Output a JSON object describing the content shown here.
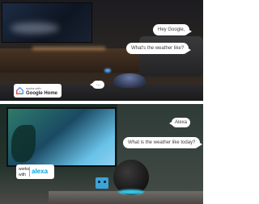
{
  "top_panel": {
    "bubbles": [
      {
        "text": "Hey Google,"
      },
      {
        "text": "What's the weather like?"
      },
      {
        "text": "..."
      }
    ],
    "badge": {
      "works_with": "works with",
      "name": "Google Home"
    }
  },
  "bottom_panel": {
    "bubbles": [
      {
        "text": "Alexa"
      },
      {
        "text": "What is the weather like today?"
      }
    ],
    "badge": {
      "works": "works",
      "with": "with",
      "name": "alexa"
    }
  },
  "colors": {
    "alexa_ring": "#36c9e8",
    "alexa_brand": "#00a8e1",
    "google_light": "#4aa8ff"
  }
}
